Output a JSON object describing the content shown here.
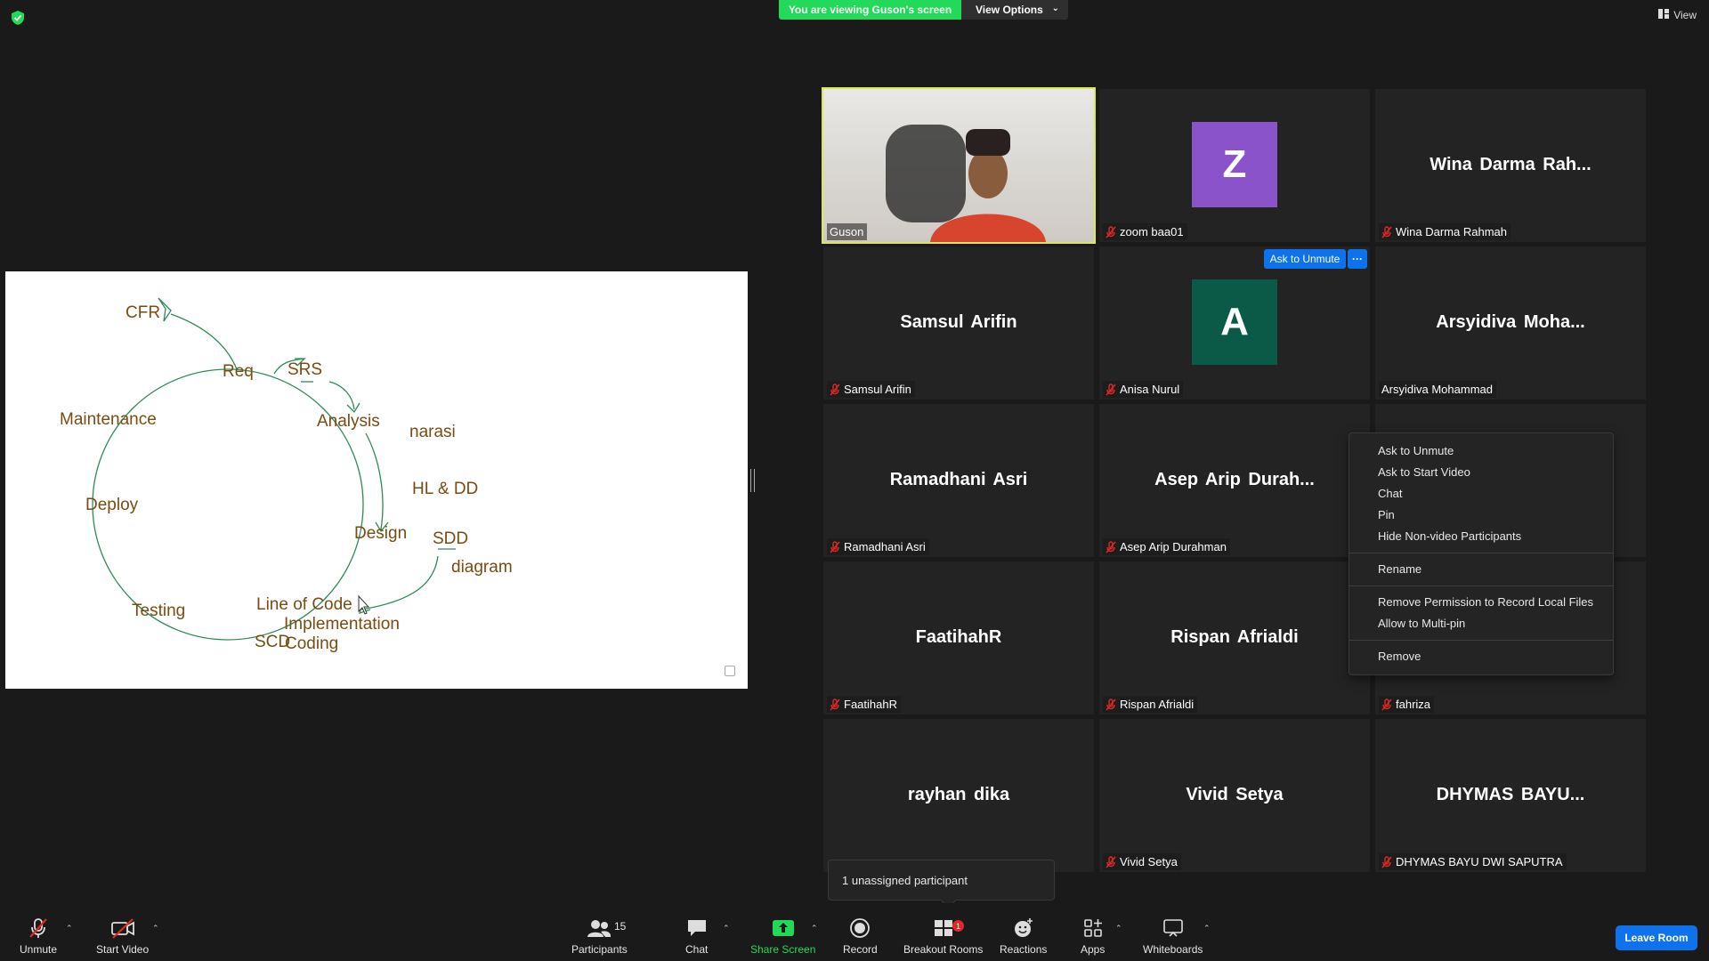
{
  "top": {
    "viewing_text": "You are viewing Guson's screen",
    "view_options_label": "View Options",
    "view_label": "View",
    "shield_icon": "shield-check-icon",
    "shield_color": "#23d959"
  },
  "whiteboard": {
    "stroke_color": "#2e8b57",
    "text_color": "#7a4b12",
    "words": {
      "cfr": "CFR",
      "req": "Req",
      "srs": "SRS",
      "analysis": "Analysis",
      "narasi": "narasi",
      "maintenance": "Maintenance",
      "hl_dd": "HL & DD",
      "deploy": "Deploy",
      "design": "Design",
      "sdd": "SDD",
      "diagram": "diagram",
      "line_of_code": "Line of Code",
      "testing": "Testing",
      "implementation": "Implementation",
      "scd": "SCD",
      "coding": "Coding"
    }
  },
  "participants": [
    {
      "name": "Guson",
      "display": "Guson",
      "type": "video",
      "muted": false,
      "active": true
    },
    {
      "name": "zoom baa01",
      "display": "Z",
      "type": "avatar",
      "avatar_color": "#8b53c9",
      "muted": true
    },
    {
      "name": "Wina Darma Rahmah",
      "display": "Wina Darma Rah...",
      "type": "name",
      "muted": true
    },
    {
      "name": "Samsul Arifin",
      "display": "Samsul Arifin",
      "type": "name",
      "muted": true
    },
    {
      "name": "Anisa Nurul",
      "display": "A",
      "type": "avatar",
      "avatar_color": "#0b5a47",
      "muted": true
    },
    {
      "name": "Arsyidiva Mohammad",
      "display": "Arsyidiva Moha...",
      "type": "name",
      "muted": false
    },
    {
      "name": "Ramadhani Asri",
      "display": "Ramadhani Asri",
      "type": "name",
      "muted": true
    },
    {
      "name": "Asep Arip Durahman",
      "display": "Asep Arip Durah...",
      "type": "name",
      "muted": true
    },
    {
      "name": "",
      "display": "",
      "type": "name",
      "muted": false
    },
    {
      "name": "FaatihahR",
      "display": "FaatihahR",
      "type": "name",
      "muted": true
    },
    {
      "name": "Rispan Afrialdi",
      "display": "Rispan Afrialdi",
      "type": "name",
      "muted": true
    },
    {
      "name": "fahriza",
      "display": "",
      "type": "name",
      "muted": true
    },
    {
      "name": "",
      "display": "rayhan dika",
      "type": "name",
      "muted": false
    },
    {
      "name": "Vivid Setya",
      "display": "Vivid Setya",
      "type": "name",
      "muted": true
    },
    {
      "name": "DHYMAS BAYU DWI SAPUTRA",
      "display": "DHYMAS  BAYU...",
      "type": "name",
      "muted": true
    }
  ],
  "tile_actions": {
    "ask_to_unmute": "Ask to Unmute",
    "more": "···"
  },
  "context_menu": {
    "group1": [
      "Ask to Unmute",
      "Ask to Start Video",
      "Chat",
      "Pin",
      "Hide Non-video Participants"
    ],
    "group2": [
      "Rename"
    ],
    "group3": [
      "Remove Permission to Record Local Files",
      "Allow to Multi-pin"
    ],
    "group4": [
      "Remove"
    ]
  },
  "tooltip": {
    "text": "1 unassigned participant"
  },
  "toolbar": {
    "unmute": "Unmute",
    "start_video": "Start Video",
    "participants": "Participants",
    "participants_count": "15",
    "chat": "Chat",
    "share_screen": "Share Screen",
    "record": "Record",
    "breakout_rooms": "Breakout Rooms",
    "breakout_badge": "1",
    "reactions": "Reactions",
    "apps": "Apps",
    "whiteboards": "Whiteboards",
    "leave_room": "Leave Room",
    "accent_green": "#23d959",
    "accent_blue": "#0e72ed",
    "mute_red": "#e02828"
  }
}
